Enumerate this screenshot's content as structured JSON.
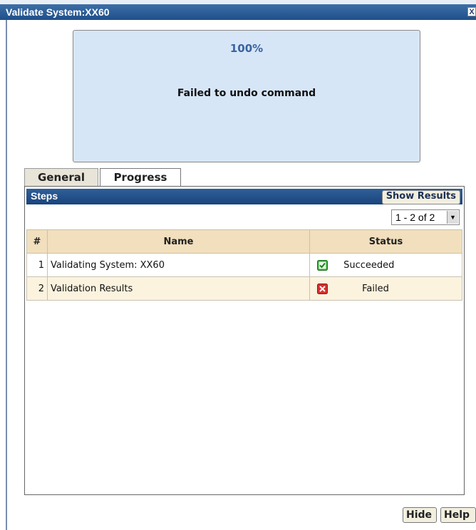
{
  "window": {
    "title": "Validate System:XX60",
    "close_glyph": "X"
  },
  "progress": {
    "percent": "100%",
    "message": "Failed to undo command"
  },
  "tabs": [
    {
      "label": "General",
      "active": false
    },
    {
      "label": "Progress",
      "active": true
    }
  ],
  "steps_panel": {
    "title": "Steps",
    "show_results_label": "Show Results",
    "pager_text": "1 - 2 of 2",
    "columns": {
      "num": "#",
      "name": "Name",
      "status": "Status"
    },
    "rows": [
      {
        "num": "1",
        "name": "Validating System: XX60",
        "status": "Succeeded",
        "icon": "success-check-icon",
        "color": "#2f9a2f"
      },
      {
        "num": "2",
        "name": "Validation Results",
        "status": "Failed",
        "icon": "failure-x-icon",
        "color": "#d32b2b"
      }
    ]
  },
  "footer": {
    "hide_label": "Hide",
    "help_label": "Help"
  }
}
